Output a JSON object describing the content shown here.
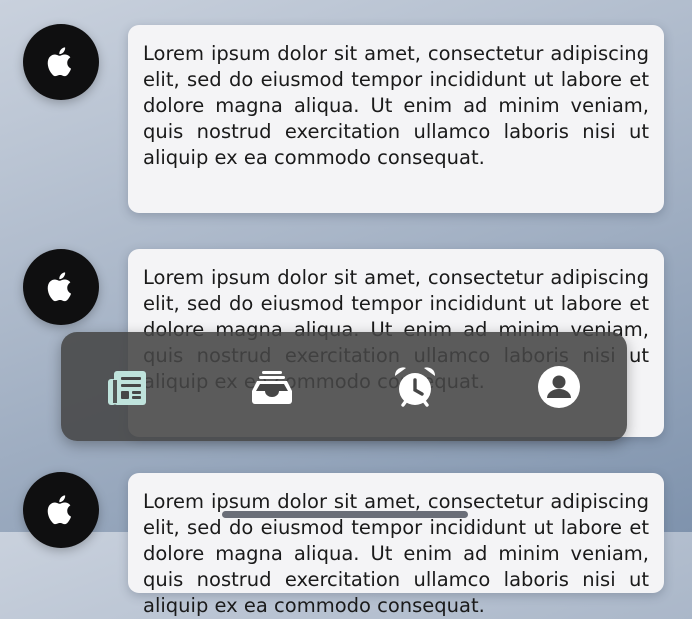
{
  "feed": {
    "posts": [
      {
        "icon": "apple-logo-icon",
        "text": "Lorem ipsum dolor sit amet, consectetur adipiscing elit, sed do eiusmod tempor incididunt ut labore et dolore magna aliqua. Ut enim ad minim veniam, quis nostrud exercitation ullamco laboris nisi ut aliquip ex ea commodo consequat."
      },
      {
        "icon": "apple-logo-icon",
        "text": "Lorem ipsum dolor sit amet, consectetur adipiscing elit, sed do eiusmod tempor incididunt ut labore et dolore magna aliqua. Ut enim ad minim veniam, quis nostrud exercitation ullamco laboris nisi ut aliquip ex ea commodo consequat."
      },
      {
        "icon": "apple-logo-icon",
        "text": "Lorem ipsum dolor sit amet, consectetur adipiscing elit, sed do eiusmod tempor incididunt ut labore et dolore magna aliqua. Ut enim ad minim veniam, quis nostrud exercitation ullamco laboris nisi ut aliquip ex ea commodo consequat."
      }
    ]
  },
  "tabbar": {
    "tabs": [
      {
        "icon": "newspaper-icon",
        "selected": true
      },
      {
        "icon": "inbox-tray-icon",
        "selected": false
      },
      {
        "icon": "alarm-clock-icon",
        "selected": false
      },
      {
        "icon": "person-circle-icon",
        "selected": false
      }
    ]
  },
  "colors": {
    "selected_tab": "#bfe3dc",
    "unselected_tab": "#ffffff",
    "bubble_bg": "#f4f4f6",
    "avatar_bg": "#0f0f10"
  }
}
